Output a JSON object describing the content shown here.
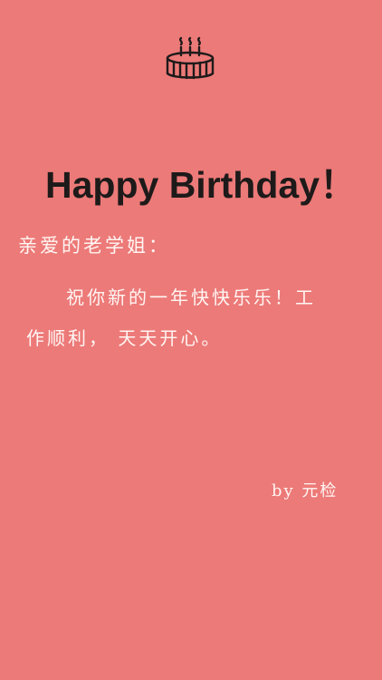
{
  "card": {
    "icon": "birthday-cake-icon",
    "title": "Happy Birthday！",
    "greeting": "亲爱的老学姐：",
    "message_line_one": "祝你新的一年快快乐乐！工",
    "message_line_two": "作顺利， 天天开心。",
    "signature": "by 元检"
  },
  "colors": {
    "background": "#ec7a78",
    "title_text": "#1e1a1a",
    "handwriting": "#fff6f4",
    "icon_stroke": "#1e1a1a"
  }
}
